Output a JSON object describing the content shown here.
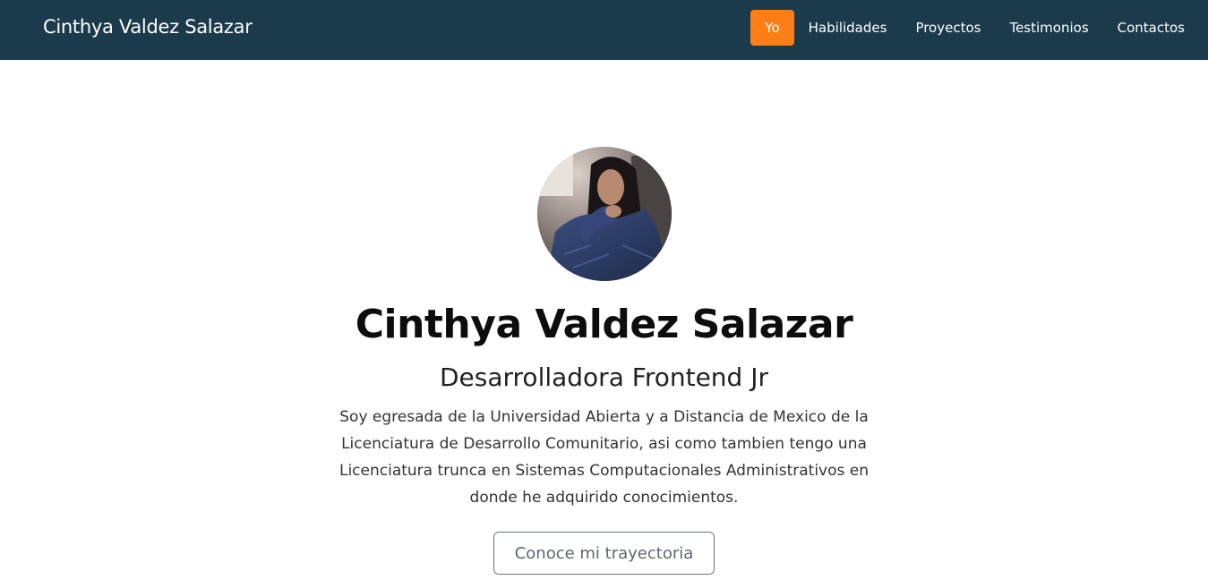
{
  "navbar": {
    "brand": "Cinthya Valdez Salazar",
    "links": [
      {
        "label": "Yo",
        "active": true
      },
      {
        "label": "Habilidades",
        "active": false
      },
      {
        "label": "Proyectos",
        "active": false
      },
      {
        "label": "Testimonios",
        "active": false
      },
      {
        "label": "Contactos",
        "active": false
      }
    ],
    "background_color": "#1b3a4b",
    "active_color": "#fd7e14"
  },
  "hero": {
    "name": "Cinthya Valdez Salazar",
    "role": "Desarrolladora Frontend Jr",
    "bio": "Soy egresada de la Universidad Abierta y a Distancia de Mexico de la Licenciatura de Desarrollo Comunitario, asi como tambien tengo una Licenciatura trunca en Sistemas Computacionales Administrativos en donde he adquirido conocimientos.",
    "cta_label": "Conoce mi trayectoria",
    "avatar_icon": "profile-photo"
  }
}
